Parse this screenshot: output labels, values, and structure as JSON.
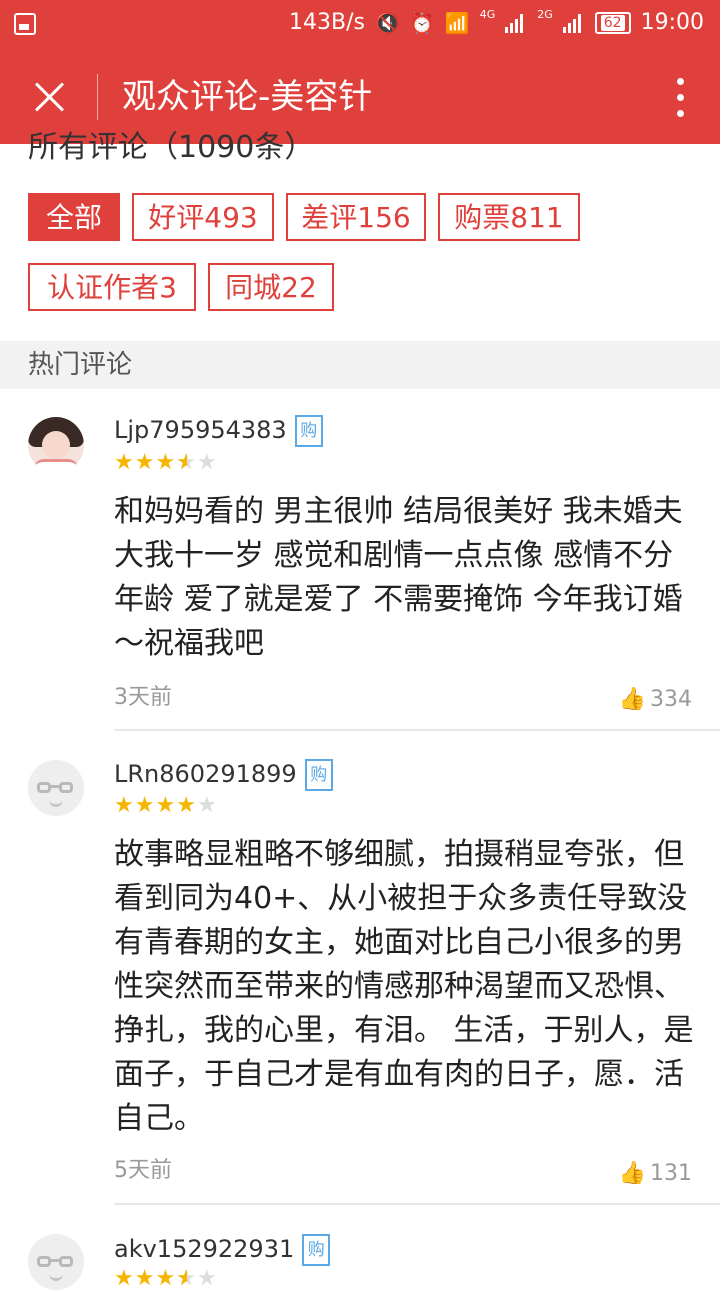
{
  "status_bar": {
    "speed": "143B/s",
    "net1": "4G",
    "net2": "2G",
    "battery": "62",
    "time": "19:00"
  },
  "app_bar": {
    "title": "观众评论-美容针"
  },
  "all_comments_header": "所有评论（1090条）",
  "filters": [
    {
      "label": "全部",
      "active": true
    },
    {
      "label": "好评493",
      "active": false
    },
    {
      "label": "差评156",
      "active": false
    },
    {
      "label": "购票811",
      "active": false
    },
    {
      "label": "认证作者3",
      "active": false
    },
    {
      "label": "同城22",
      "active": false
    }
  ],
  "section_title": "热门评论",
  "buy_badge": "购",
  "comments": [
    {
      "username": "Ljp795954383",
      "rating": 3.5,
      "text": "和妈妈看的 男主很帅 结局很美好 我未婚夫大我十一岁 感觉和剧情一点点像 感情不分年龄 爱了就是爱了 不需要掩饰 今年我订婚～祝福我吧",
      "time": "3天前",
      "likes": "334"
    },
    {
      "username": "LRn860291899",
      "rating": 4,
      "text": "故事略显粗略不够细腻，拍摄稍显夸张，但看到同为40+、从小被担于众多责任导致没有青春期的女主，她面对比自己小很多的男性突然而至带来的情感那种渴望而又恐惧、挣扎，我的心里，有泪。 生活，于别人，是面子，于自己才是有血有肉的日子，愿．活自己。",
      "time": "5天前",
      "likes": "131"
    },
    {
      "username": "akv152922931",
      "rating": 3.5
    }
  ]
}
